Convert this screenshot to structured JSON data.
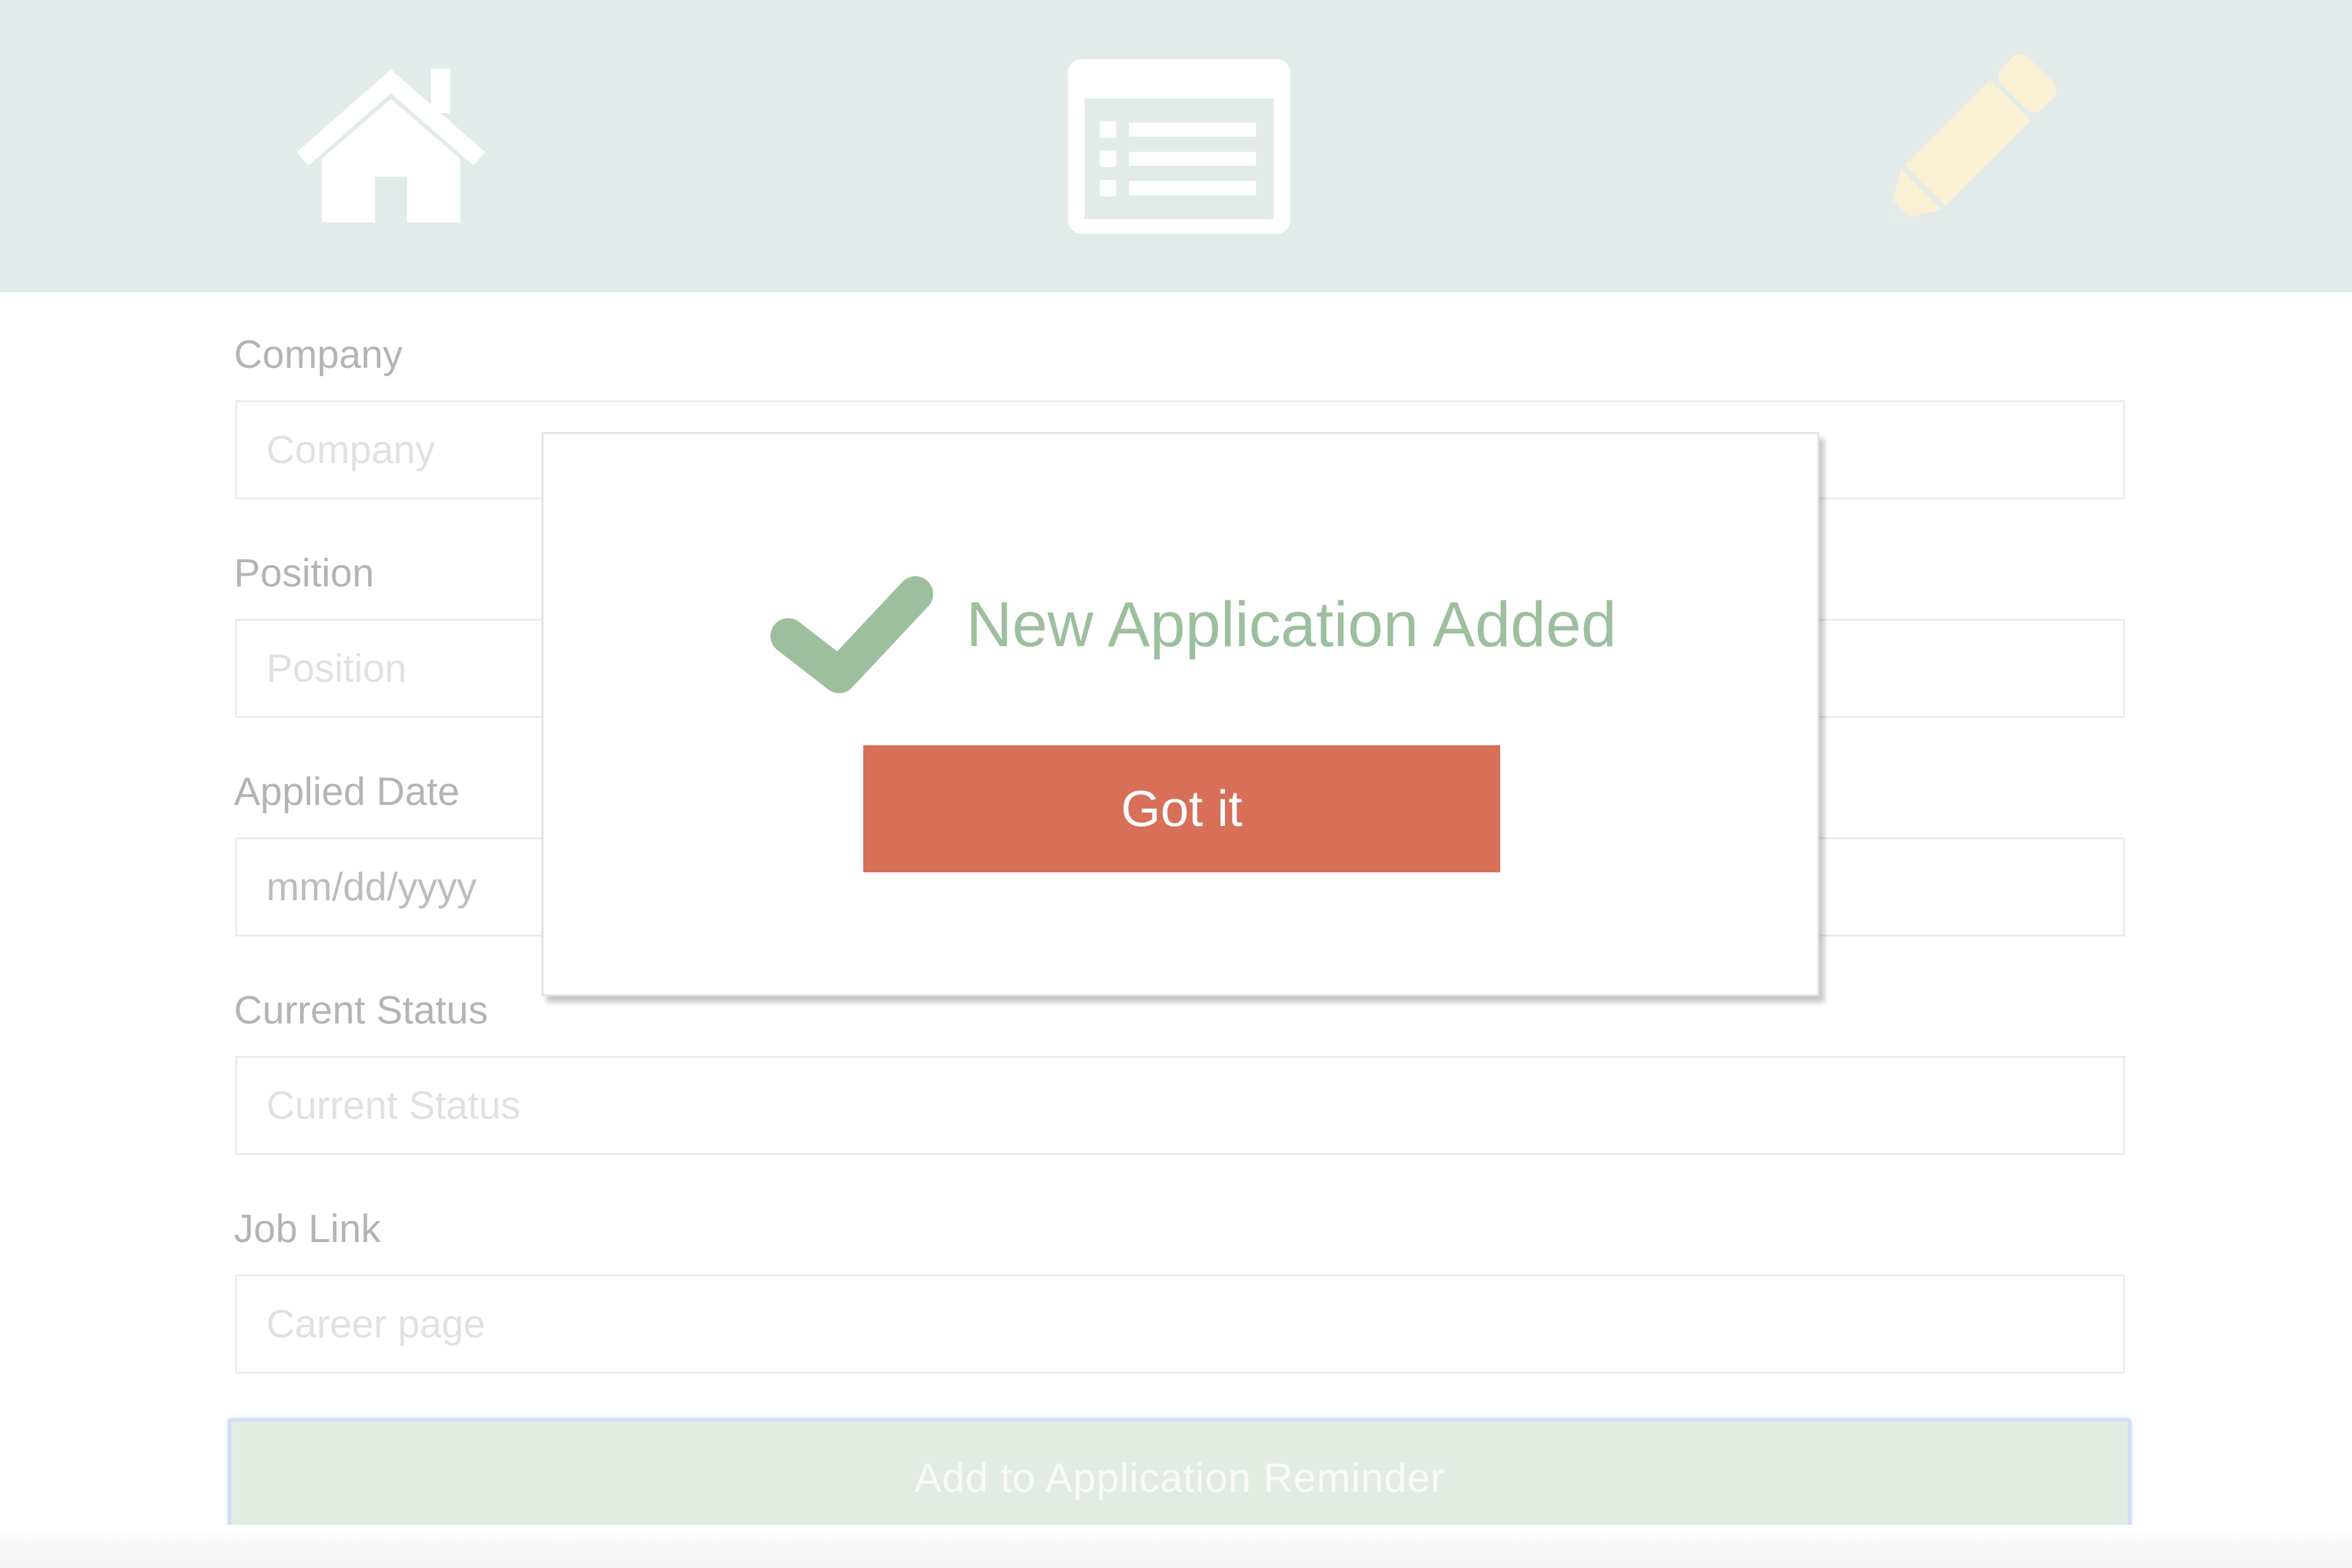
{
  "nav": {
    "items": [
      {
        "icon": "home-icon"
      },
      {
        "icon": "list-icon"
      },
      {
        "icon": "pencil-icon"
      }
    ],
    "colors": {
      "bar": "#e3ebea",
      "icon": "#ffffff",
      "active_icon": "#faf0d4"
    }
  },
  "form": {
    "company": {
      "label": "Company",
      "placeholder": "Company"
    },
    "position": {
      "label": "Position",
      "placeholder": "Position"
    },
    "applied_date": {
      "label": "Applied Date",
      "value": "mm/dd/yyyy"
    },
    "current_status": {
      "label": "Current Status",
      "placeholder": "Current Status"
    },
    "job_link": {
      "label": "Job Link",
      "placeholder": "Career page"
    },
    "submit_label": "Add to Application Reminder"
  },
  "modal": {
    "icon": "checkmark-icon",
    "title": "New Application Added",
    "button_label": "Got it",
    "colors": {
      "success": "#9dbf9e",
      "button": "#d86f59"
    }
  }
}
